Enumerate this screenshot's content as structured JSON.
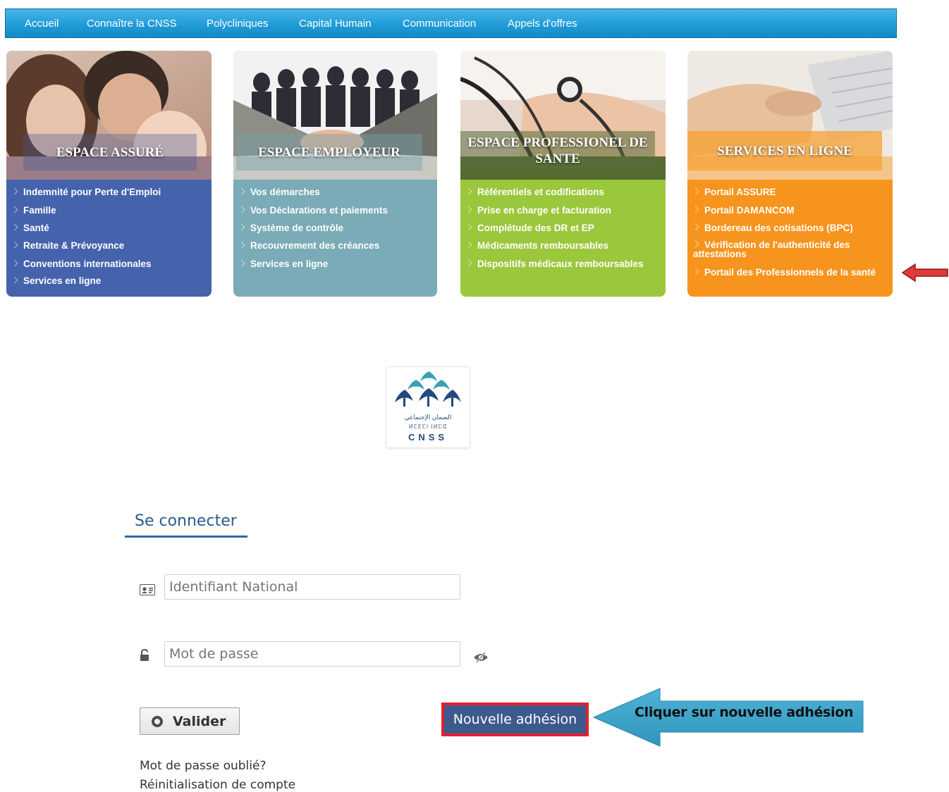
{
  "nav": {
    "items": [
      "Accueil",
      "Connaître la CNSS",
      "Polycliniques",
      "Capital Humain",
      "Communication",
      "Appels d'offres"
    ]
  },
  "cards": [
    {
      "title": "ESPACE ASSURÉ",
      "color": "#4463ac",
      "links": [
        "Indemnité pour Perte d'Emploi",
        "Famille",
        "Santé",
        "Retraite & Prévoyance",
        "Conventions internationales",
        "Services en ligne"
      ]
    },
    {
      "title": "ESPACE EMPLOYEUR",
      "color": "#7aabb7",
      "links": [
        "Vos démarches",
        "Vos Déclarations et paiements",
        "Système de contrôle",
        "Recouvrement des créances",
        "Services en ligne"
      ]
    },
    {
      "title": "ESPACE PROFESSIONEL DE SANTE",
      "color": "#9bc73c",
      "links": [
        "Référentiels et codifications",
        "Prise en charge et facturation",
        "Complétude des DR et EP",
        "Médicaments remboursables",
        "Dispositifs médicaux remboursables"
      ]
    },
    {
      "title": "SERVICES EN LIGNE",
      "color": "#f7941d",
      "links": [
        "Portail ASSURE",
        "Portail DAMANCOM",
        "Bordereau des cotisations (BPC)",
        "Vérification de l'authenticité des attestations",
        "Portail des Professionnels de la santé"
      ]
    }
  ],
  "logo": {
    "arabic": "الضمان الإجتماعي",
    "tifinagh": "ⵍⵎⴹⵎⵏ ⵏⵍⵎⵛ",
    "name": "CNSS"
  },
  "login": {
    "title": "Se connecter",
    "id_placeholder": "Identifiant National",
    "password_placeholder": "Mot de passe",
    "validate_label": "Valider",
    "new_membership_label": "Nouvelle adhésion",
    "callout_text": "Cliquer sur nouvelle adhésion",
    "forgot_password": "Mot de passe oublié?",
    "reset_account": "Réinitialisation de compte"
  }
}
